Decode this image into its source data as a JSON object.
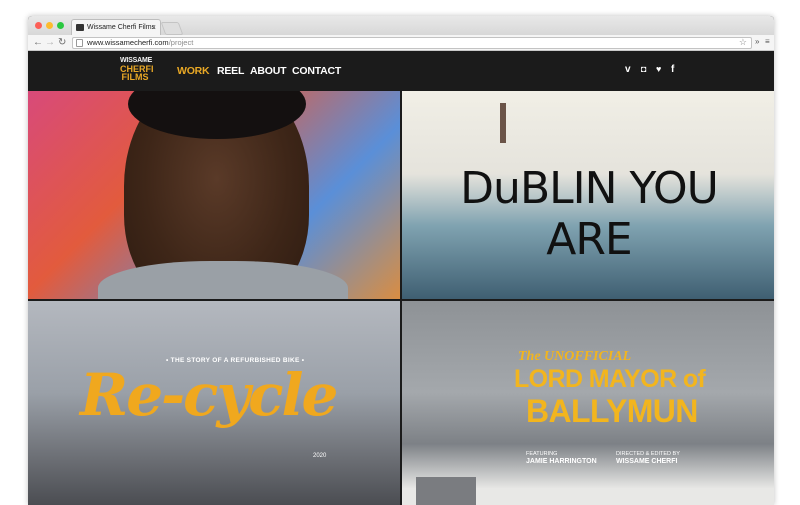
{
  "browser": {
    "tab_title": "Wissame Cherfi Films",
    "url_host": "www.wissamecherfi.com",
    "url_path": "/project"
  },
  "site": {
    "logo": {
      "line1": "WISSAME",
      "line2": "CHERFI",
      "line3": "FILMS"
    },
    "menu": [
      {
        "label": "WORK",
        "active": true
      },
      {
        "label": "REEL",
        "active": false
      },
      {
        "label": "ABOUT",
        "active": false
      },
      {
        "label": "CONTACT",
        "active": false
      }
    ],
    "social": [
      {
        "icon": "vimeo-icon",
        "glyph": "v"
      },
      {
        "icon": "instagram-icon",
        "glyph": "◘"
      },
      {
        "icon": "twitter-icon",
        "glyph": "♥"
      },
      {
        "icon": "facebook-icon",
        "glyph": "f"
      }
    ],
    "accent": "#e9a825"
  },
  "projects": [
    {
      "id": "portrait"
    },
    {
      "id": "dublin",
      "title": "DuBLIN YOU ARE"
    },
    {
      "id": "recycle",
      "tagline": "• THE STORY OF A REFURBISHED BIKE •",
      "title": "Re-cycle",
      "meta": "2020"
    },
    {
      "id": "lordmayor",
      "title_line1": "The UNOFFICIAL",
      "title_line2": "LORD MAYOR of",
      "title_line3": "BALLYMUN",
      "featuring_label": "FEATURING",
      "featuring_name": "JAMIE HARRINGTON",
      "director_label": "DIRECTED & EDITED BY",
      "director_name": "WISSAME CHERFI"
    }
  ]
}
